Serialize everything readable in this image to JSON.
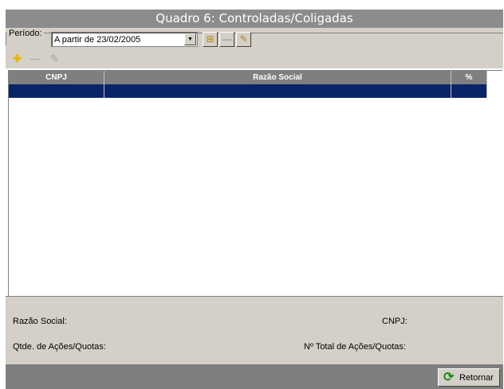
{
  "window": {
    "title": "Quadro 6: Controladas/Coligadas"
  },
  "periodo": {
    "label": "Período:",
    "selected": "A partir de 23/02/2005"
  },
  "toolbar": {
    "icons": [
      "calendar-add-icon",
      "minus-icon",
      "pencil-icon"
    ]
  },
  "row_actions": {
    "icons": [
      "add-icon",
      "remove-icon",
      "edit-icon"
    ]
  },
  "grid": {
    "columns": [
      "CNPJ",
      "Razão Social",
      "%"
    ],
    "rows": [
      [
        "",
        "",
        ""
      ]
    ],
    "selected_row_color": "#0a246a"
  },
  "details": {
    "razao_social_label": "Razão Social:",
    "cnpj_label": "CNPJ:",
    "qtde_label": "Qtde. de Ações/Quotas:",
    "total_label": "Nº Total de Ações/Quotas:"
  },
  "footer": {
    "retornar_label": "Retornar"
  },
  "colors": {
    "title_bg": "#8c8c8c",
    "panel_bg": "#d4d0c8",
    "footer_bg": "#7f7f7f"
  }
}
